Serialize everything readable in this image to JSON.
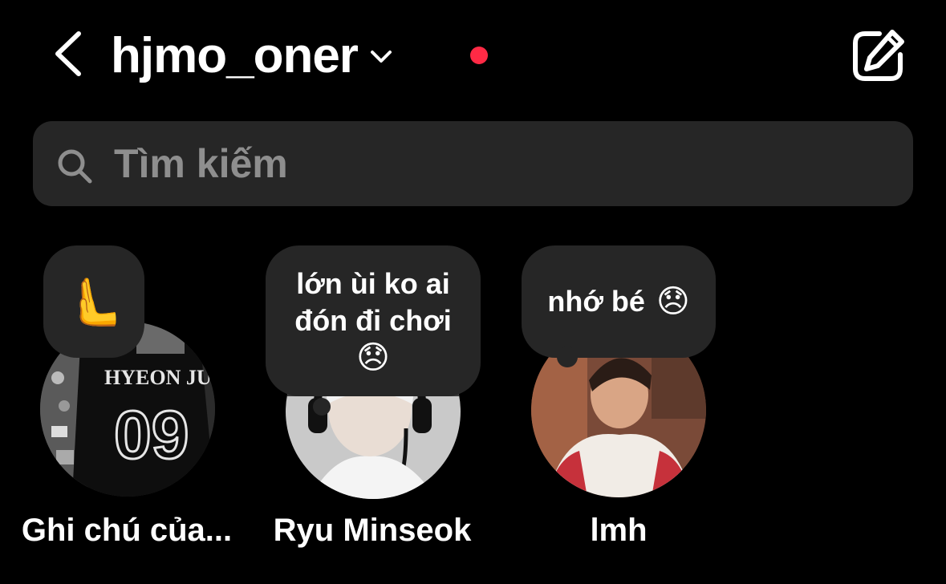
{
  "header": {
    "account_name": "hjmo_oner",
    "back_icon": "chevron-left-icon",
    "dropdown_icon": "chevron-down-icon",
    "compose_icon": "compose-icon",
    "notification_color": "#ff2a45"
  },
  "search": {
    "placeholder": "Tìm kiếm",
    "icon": "search-icon"
  },
  "notes": [
    {
      "label": "Ghi chú của...",
      "note_emoji": "🫷",
      "avatar_text_line1": "HYEON JUN",
      "avatar_text_line2": "09"
    },
    {
      "label": "Ryu Minseok",
      "note_line1": "lớn ùi ko ai",
      "note_line2": "đón đi chơi",
      "note_emoji": "😞"
    },
    {
      "label": "lmh",
      "note_text": "nhớ bé",
      "note_emoji": "😞"
    }
  ],
  "colors": {
    "background": "#000000",
    "surface": "#262626",
    "placeholder": "#8e8e8e",
    "text": "#ffffff"
  }
}
